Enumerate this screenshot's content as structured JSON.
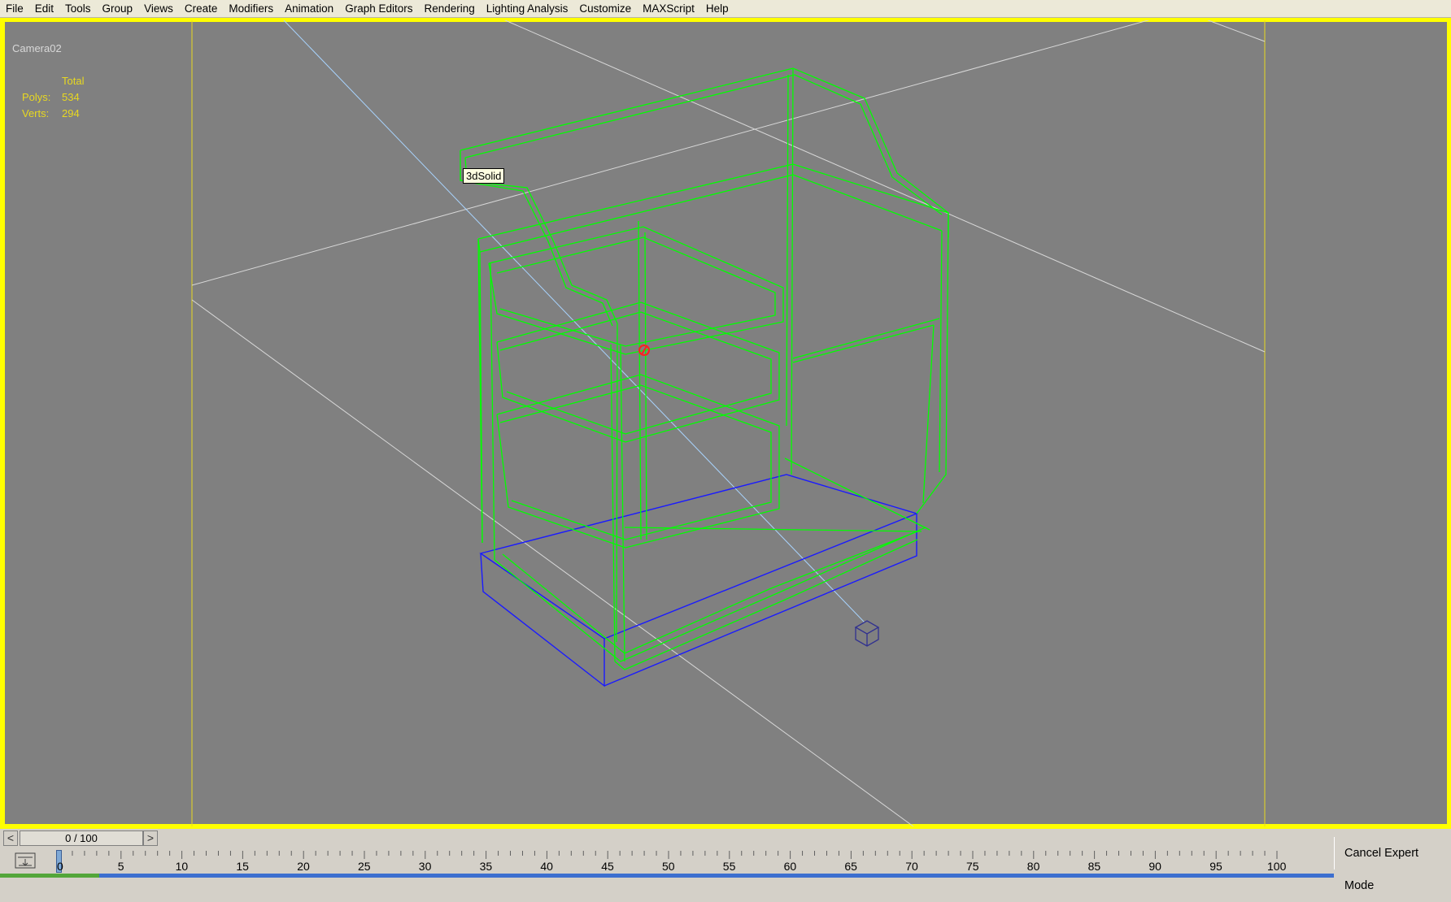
{
  "menu": {
    "items": [
      "File",
      "Edit",
      "Tools",
      "Group",
      "Views",
      "Create",
      "Modifiers",
      "Animation",
      "Graph Editors",
      "Rendering",
      "Lighting Analysis",
      "Customize",
      "MAXScript",
      "Help"
    ]
  },
  "viewport": {
    "label": "Camera02",
    "stats": {
      "header": "Total",
      "polys_label": "Polys:",
      "polys_value": "534",
      "verts_label": "Verts:",
      "verts_value": "294"
    },
    "tooltip": "3dSolid",
    "colors": {
      "background": "#808080",
      "active_border": "#ffff00",
      "wireframe": "#00ff00",
      "selection_box": "#1a1aff",
      "stats_text": "#e8d820"
    }
  },
  "timeline": {
    "slider_text": "0 / 100",
    "prev_label": "<",
    "next_label": ">",
    "ticks": [
      "0",
      "5",
      "10",
      "15",
      "20",
      "25",
      "30",
      "35",
      "40",
      "45",
      "50",
      "55",
      "60",
      "65",
      "70",
      "75",
      "80",
      "85",
      "90",
      "95",
      "100"
    ],
    "current_frame": 0,
    "total_frames": 100
  },
  "status": {
    "cancel_expert_label": "Cancel Expert Mode"
  },
  "icons": {
    "filter": "key-filter-icon",
    "camera_target": "camera-target-cube-icon",
    "pivot": "pivot-marker-icon"
  }
}
